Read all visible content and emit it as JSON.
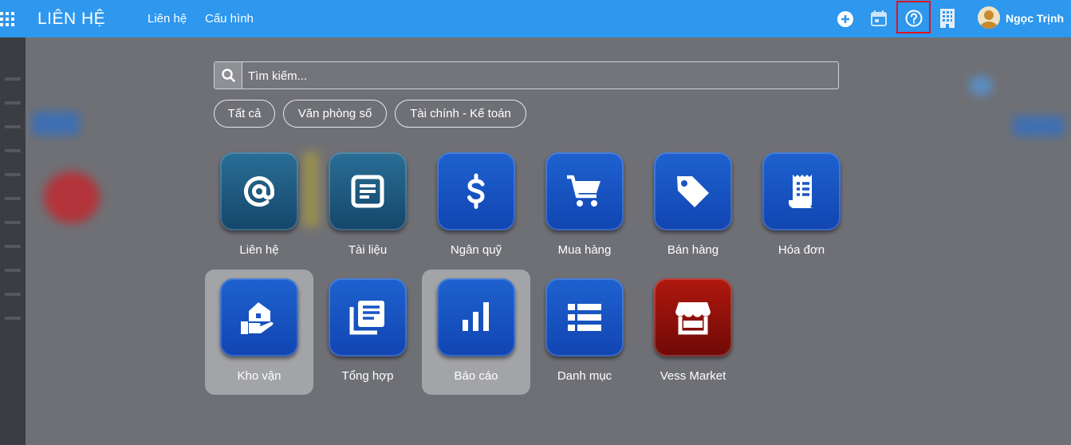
{
  "topbar": {
    "app_title": "LIÊN HỆ",
    "nav": [
      "Liên hệ",
      "Cấu hình"
    ],
    "icons": [
      "apps-grid-icon",
      "plus-circle-icon",
      "calendar-icon",
      "help-circle-icon",
      "building-icon"
    ],
    "user_name": "Ngọc Trịnh"
  },
  "search": {
    "placeholder": "Tìm kiếm..."
  },
  "filters": [
    "Tất cả",
    "Văn phòng số",
    "Tài chính - Kế toán"
  ],
  "apps": [
    {
      "label": "Liên hệ",
      "icon": "at-sign-icon",
      "color": "#1d5f86"
    },
    {
      "label": "Tài liệu",
      "icon": "document-icon",
      "color": "#1d5f86"
    },
    {
      "label": "Ngân quỹ",
      "icon": "dollar-icon",
      "color": "#1b55c4"
    },
    {
      "label": "Mua hàng",
      "icon": "cart-icon",
      "color": "#1b55c4"
    },
    {
      "label": "Bán hàng",
      "icon": "tag-icon",
      "color": "#1b55c4"
    },
    {
      "label": "Hóa đơn",
      "icon": "receipt-icon",
      "color": "#1b55c4"
    },
    {
      "label": "Kho vận",
      "icon": "warehouse-hand-icon",
      "color": "#1b55c4"
    },
    {
      "label": "Tổng hợp",
      "icon": "library-icon",
      "color": "#1b55c4"
    },
    {
      "label": "Báo cáo",
      "icon": "bar-chart-icon",
      "color": "#1b55c4"
    },
    {
      "label": "Danh mục",
      "icon": "list-icon",
      "color": "#1b55c4"
    },
    {
      "label": "Vess Market",
      "icon": "store-icon",
      "color": "#9a140c"
    }
  ],
  "colors": {
    "topbar": "#2e97ee",
    "highlight_border": "#e0141b"
  }
}
